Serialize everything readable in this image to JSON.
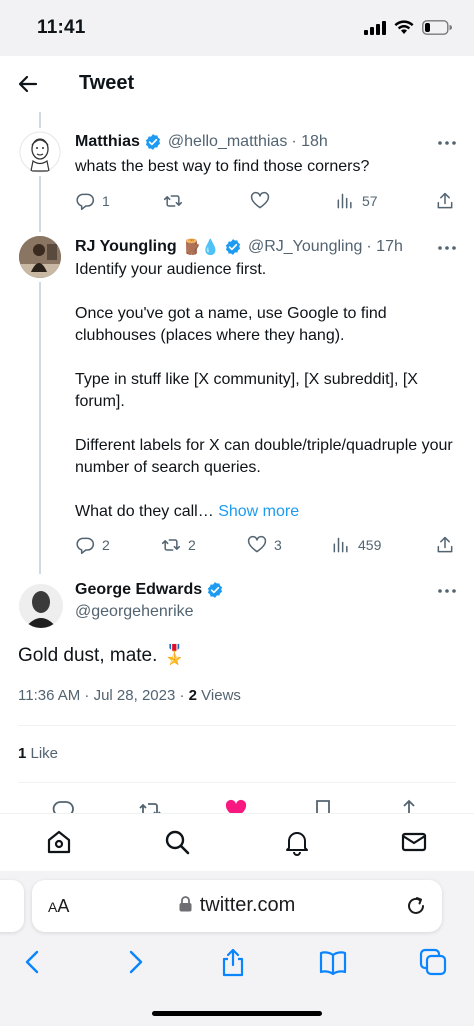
{
  "status": {
    "time": "11:41"
  },
  "header": {
    "title": "Tweet"
  },
  "tweets": [
    {
      "name": "Matthias",
      "handle": "@hello_matthias",
      "time": "· 18h",
      "text": "whats the best way to find those corners?",
      "replies": "1",
      "retweets": "",
      "likes": "",
      "views": "57"
    },
    {
      "name": "RJ Youngling",
      "emoji": "🪵💧",
      "handle": "@RJ_Youngling",
      "time": "· 17h",
      "text": "Identify your audience first.\n\nOnce you've got a name, use Google to find clubhouses (places where they hang).\n\nType in stuff like [X community], [X subreddit], [X forum].\n\nDifferent labels for X can double/triple/quadruple your number of search queries.\n\nWhat do they call…",
      "show_more": "Show more",
      "replies": "2",
      "retweets": "2",
      "likes": "3",
      "views": "459"
    }
  ],
  "main_tweet": {
    "name": "George Edwards",
    "handle": "@georgehenrike",
    "text": "Gold dust, mate. 🎖️",
    "timestamp": "11:36 AM · Jul 28, 2023 · ",
    "views_count": "2",
    "views_label": " Views",
    "likes_count": "1",
    "likes_label": " Like"
  },
  "browser": {
    "aa_label_a": "A",
    "aa_label_big": "A",
    "url": "twitter.com"
  },
  "colors": {
    "accent": "#1d9bf0",
    "like_active": "#f91880",
    "muted": "#536471"
  }
}
